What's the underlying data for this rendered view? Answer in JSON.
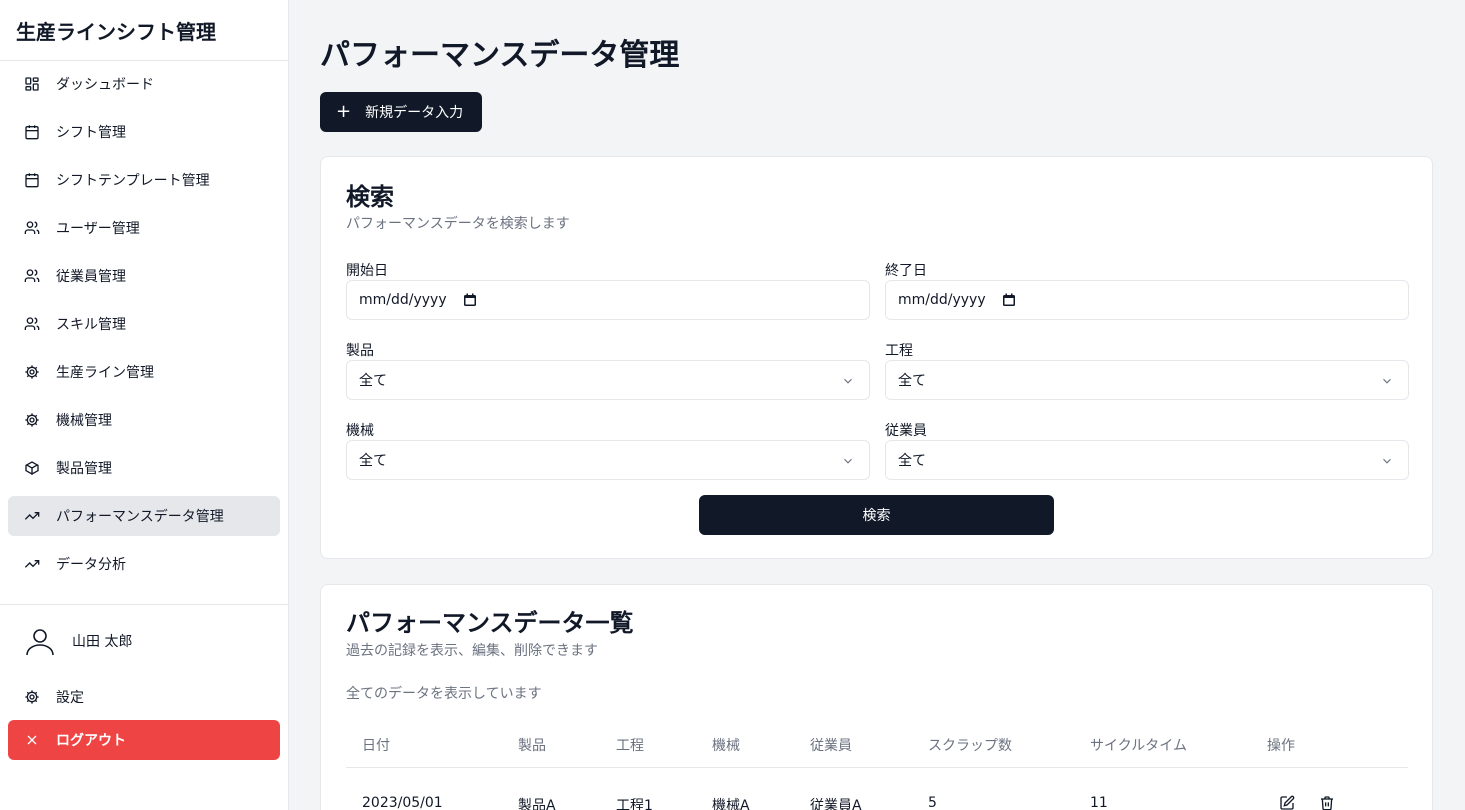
{
  "app": {
    "title": "生産ラインシフト管理"
  },
  "sidebar": {
    "items": [
      {
        "label": "ダッシュボード",
        "icon": "dashboard-icon"
      },
      {
        "label": "シフト管理",
        "icon": "calendar-icon"
      },
      {
        "label": "シフトテンプレート管理",
        "icon": "calendar-icon"
      },
      {
        "label": "ユーザー管理",
        "icon": "users-icon"
      },
      {
        "label": "従業員管理",
        "icon": "users-icon"
      },
      {
        "label": "スキル管理",
        "icon": "users-icon"
      },
      {
        "label": "生産ライン管理",
        "icon": "gear-icon"
      },
      {
        "label": "機械管理",
        "icon": "gear-icon"
      },
      {
        "label": "製品管理",
        "icon": "box-icon"
      },
      {
        "label": "パフォーマンスデータ管理",
        "icon": "trending-up-icon",
        "active": true
      },
      {
        "label": "データ分析",
        "icon": "trending-up-icon"
      }
    ],
    "user_name": "山田 太郎",
    "settings_label": "設定",
    "logout_label": "ログアウト"
  },
  "page": {
    "title": "パフォーマンスデータ管理",
    "new_button": "新規データ入力"
  },
  "search": {
    "title": "検索",
    "subtitle": "パフォーマンスデータを検索します",
    "start_label": "開始日",
    "start_value": "mm/dd/yyyy",
    "end_label": "終了日",
    "end_value": "mm/dd/yyyy",
    "product_label": "製品",
    "product_value": "全て",
    "process_label": "工程",
    "process_value": "全て",
    "machine_label": "機械",
    "machine_value": "全て",
    "employee_label": "従業員",
    "employee_value": "全て",
    "button": "検索"
  },
  "list": {
    "title": "パフォーマンスデータ一覧",
    "subtitle": "過去の記録を表示、編集、削除できます",
    "info": "全てのデータを表示しています",
    "columns": [
      "日付",
      "製品",
      "工程",
      "機械",
      "従業員",
      "スクラップ数",
      "サイクルタイム",
      "操作"
    ],
    "rows": [
      [
        "2023/05/01",
        "製品A",
        "工程1",
        "機械A",
        "従業員A",
        "5",
        "11"
      ]
    ]
  },
  "colors": {
    "primary": "#111827",
    "danger": "#ef4444",
    "active_bg": "#e5e7eb",
    "page_bg": "#f3f4f6"
  }
}
